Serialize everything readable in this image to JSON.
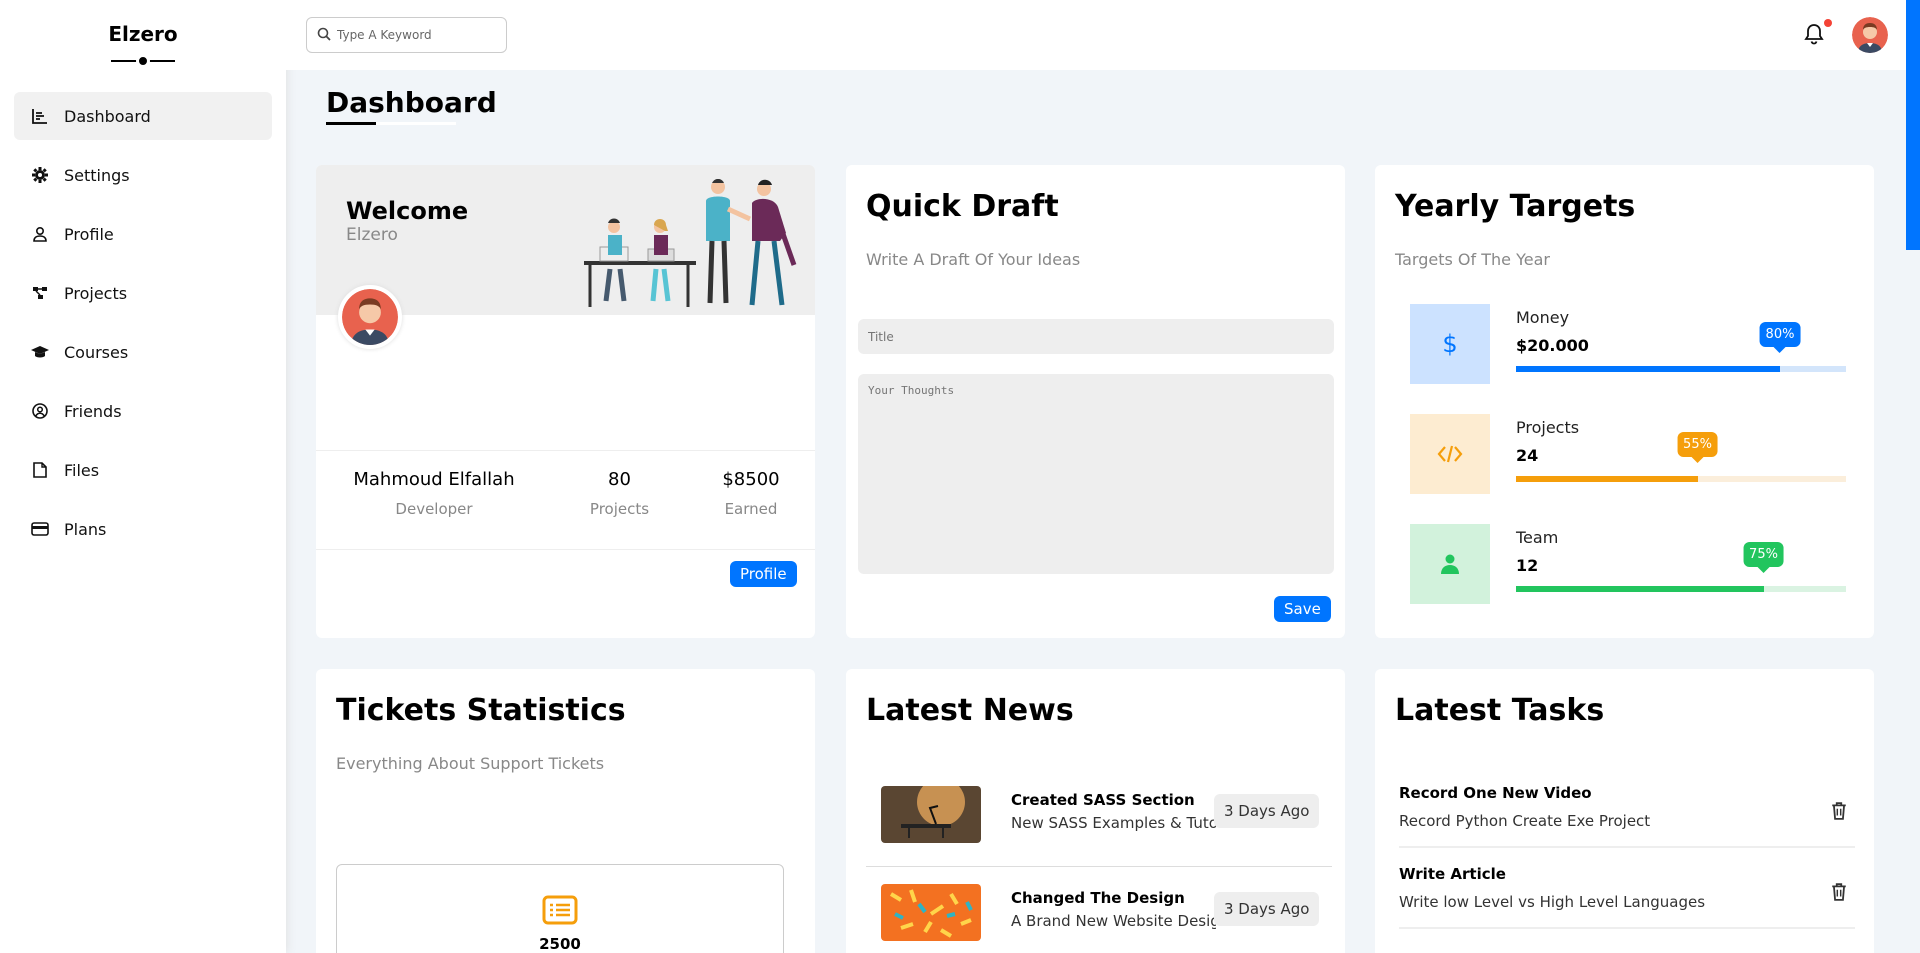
{
  "sidebar": {
    "brand": "Elzero",
    "items": [
      {
        "label": "Dashboard",
        "icon": "chart-icon"
      },
      {
        "label": "Settings",
        "icon": "gear-icon"
      },
      {
        "label": "Profile",
        "icon": "user-icon"
      },
      {
        "label": "Projects",
        "icon": "diagram-icon"
      },
      {
        "label": "Courses",
        "icon": "graduation-cap-icon"
      },
      {
        "label": "Friends",
        "icon": "user-circle-icon"
      },
      {
        "label": "Files",
        "icon": "file-icon"
      },
      {
        "label": "Plans",
        "icon": "credit-card-icon"
      }
    ]
  },
  "header": {
    "search_placeholder": "Type A Keyword"
  },
  "page": {
    "title": "Dashboard"
  },
  "welcome": {
    "title": "Welcome",
    "name": "Elzero",
    "stats": [
      {
        "value": "Mahmoud Elfallah",
        "label": "Developer"
      },
      {
        "value": "80",
        "label": "Projects"
      },
      {
        "value": "$8500",
        "label": "Earned"
      }
    ],
    "button": "Profile"
  },
  "draft": {
    "title": "Quick Draft",
    "subtitle": "Write A Draft Of Your Ideas",
    "title_placeholder": "Title",
    "body_placeholder": "Your Thoughts",
    "button": "Save"
  },
  "targets": {
    "title": "Yearly Targets",
    "subtitle": "Targets Of The Year",
    "items": [
      {
        "label": "Money",
        "value": "$20.000",
        "percent": 80,
        "percent_label": "80%",
        "color": "#0075ff",
        "bg": "#cce2ff",
        "track": "#d3e5fb",
        "icon": "$"
      },
      {
        "label": "Projects",
        "value": "24",
        "percent": 55,
        "percent_label": "55%",
        "color": "#f59e0b",
        "bg": "#fdecd1",
        "track": "#fbeedb",
        "icon": "</>"
      },
      {
        "label": "Team",
        "value": "12",
        "percent": 75,
        "percent_label": "75%",
        "color": "#22c55e",
        "bg": "#d2f2dc",
        "track": "#daf3e2",
        "icon": "user"
      }
    ]
  },
  "tickets": {
    "title": "Tickets Statistics",
    "subtitle": "Everything About Support Tickets",
    "first_value": "2500",
    "accent": "#f59e0b"
  },
  "news": {
    "title": "Latest News",
    "items": [
      {
        "title": "Created SASS Section",
        "desc": "New SASS Examples & Tutorials",
        "date": "3 Days Ago"
      },
      {
        "title": "Changed The Design",
        "desc": "A Brand New Website Design",
        "date": "3 Days Ago"
      }
    ]
  },
  "tasks": {
    "title": "Latest Tasks",
    "items": [
      {
        "title": "Record One New Video",
        "desc": "Record Python Create Exe Project"
      },
      {
        "title": "Write Article",
        "desc": "Write low Level vs High Level Languages"
      }
    ]
  }
}
